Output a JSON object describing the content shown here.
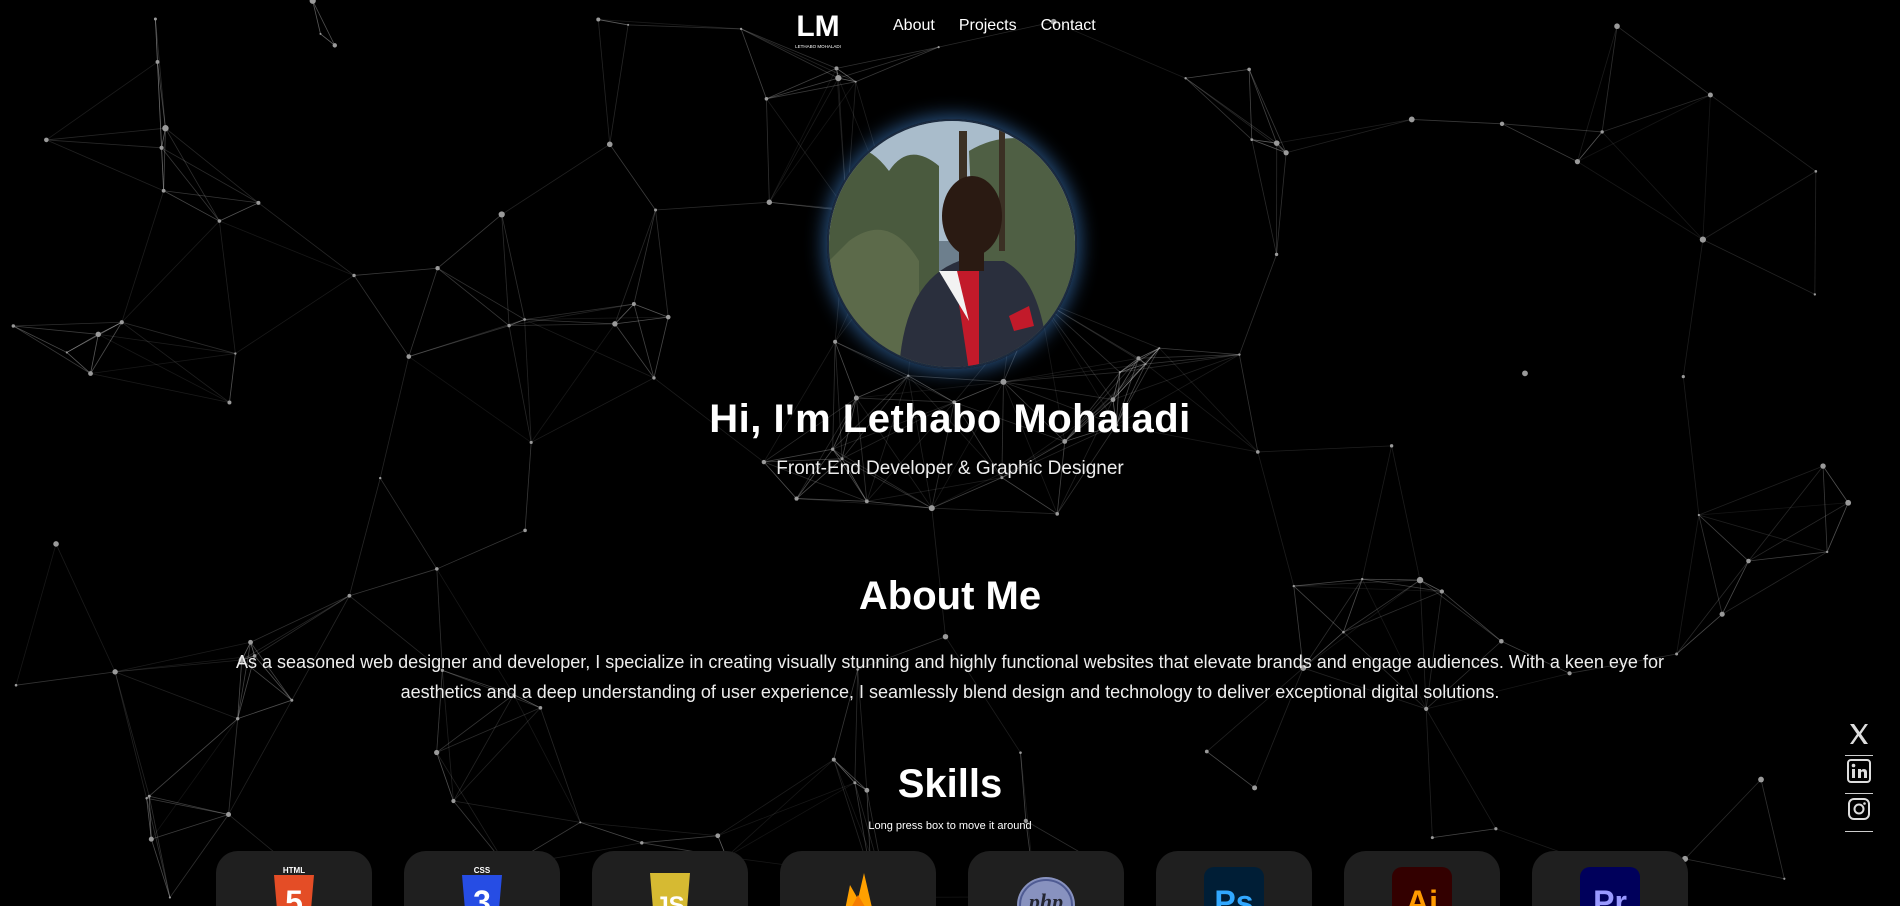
{
  "nav": {
    "logo_text": "LM",
    "logo_subtext": "LETHABO MOHALADI",
    "links": [
      "About",
      "Projects",
      "Contact"
    ]
  },
  "hero": {
    "title": "Hi, I'm Lethabo Mohaladi",
    "subtitle": "Front-End Developer & Graphic Designer"
  },
  "about": {
    "title": "About Me",
    "text": "As a seasoned web designer and developer, I specialize in creating visually stunning and highly functional websites that elevate brands and engage audiences. With a keen eye for aesthetics and a deep understanding of user experience, I seamlessly blend design and technology to deliver exceptional digital solutions."
  },
  "skills": {
    "title": "Skills",
    "hint": "Long press box to move it around",
    "items": [
      {
        "icon": "html5-icon",
        "label": "5",
        "caption": "HTML",
        "color": "#e44d26"
      },
      {
        "icon": "css3-icon",
        "label": "3",
        "caption": "CSS",
        "color": "#264de4"
      },
      {
        "icon": "javascript-icon",
        "label": "JS",
        "color": "#f0db4f"
      },
      {
        "icon": "firebase-icon",
        "color": "#ffa000"
      },
      {
        "icon": "php-icon",
        "label": "php",
        "color": "#8892bf"
      },
      {
        "icon": "photoshop-icon",
        "label": "Ps",
        "color": "#31a8ff"
      },
      {
        "icon": "illustrator-icon",
        "label": "Ai",
        "color": "#ff9a00"
      },
      {
        "icon": "premiere-icon",
        "label": "Pr",
        "color": "#9999ff"
      }
    ]
  },
  "social": [
    "x-twitter-icon",
    "linkedin-icon",
    "instagram-icon"
  ]
}
